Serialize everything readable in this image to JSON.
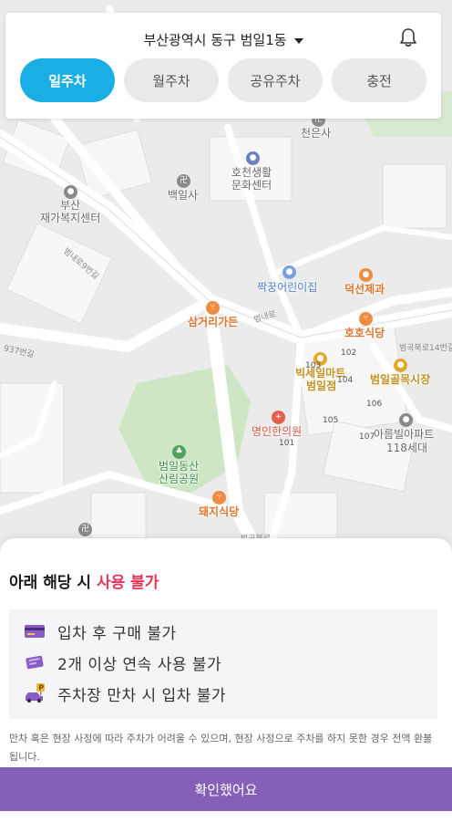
{
  "header": {
    "location": "부산광역시 동구 범일1동",
    "tabs": [
      {
        "label": "일주차",
        "active": true
      },
      {
        "label": "월주차",
        "active": false
      },
      {
        "label": "공유주차",
        "active": false
      },
      {
        "label": "충전",
        "active": false
      }
    ]
  },
  "map": {
    "pois": {
      "cheoneunsa": "천은사",
      "hocheon_line1": "호천생활",
      "hocheon_line2": "문화센터",
      "baegilsa": "백일사",
      "busan_line1": "부산",
      "busan_line2": "재가복지센터",
      "jjakkung": "짝꿍어린이집",
      "deokseon": "덕선제과",
      "samgeori": "삼거리가든",
      "hoho": "호호식당",
      "bigsale_line1": "빅세일마트",
      "bigsale_line2": "범일점",
      "beomil_market": "범일골목시장",
      "myeongin": "명인한의원",
      "areumvilla_line1": "아름빌아파트",
      "areumvilla_line2": "118세대",
      "park_line1": "범일동산",
      "park_line2": "산림공원",
      "dwaeji": "돼지식당"
    },
    "roads": {
      "r1": "범내로9번길",
      "r2": "범내로",
      "r3": "937번길",
      "r4": "범곡북로14번길",
      "r5": "범곡북로"
    },
    "buildings": [
      "101",
      "102",
      "103",
      "104",
      "105",
      "106",
      "107"
    ]
  },
  "sheet": {
    "title_prefix": "아래 해당 시 ",
    "title_highlight": "사용 불가",
    "rules": [
      {
        "icon": "credit-card-icon",
        "text": "입차 후 구매 불가"
      },
      {
        "icon": "ticket-icon",
        "text": "2개 이상 연속 사용 불가"
      },
      {
        "icon": "parking-full-icon",
        "text": "주차장 만차 시 입차 불가"
      }
    ],
    "notice": "만차 혹은 현장 사정에 따라 주차가 어려울 수 있으며, 현장 사정으로 주차를 하지 못한 경우 전액 환불됩니다.",
    "confirm_label": "확인했어요"
  },
  "colors": {
    "tab_active": "#1aaee5",
    "warning": "#ea3558",
    "confirm": "#8560b8"
  }
}
